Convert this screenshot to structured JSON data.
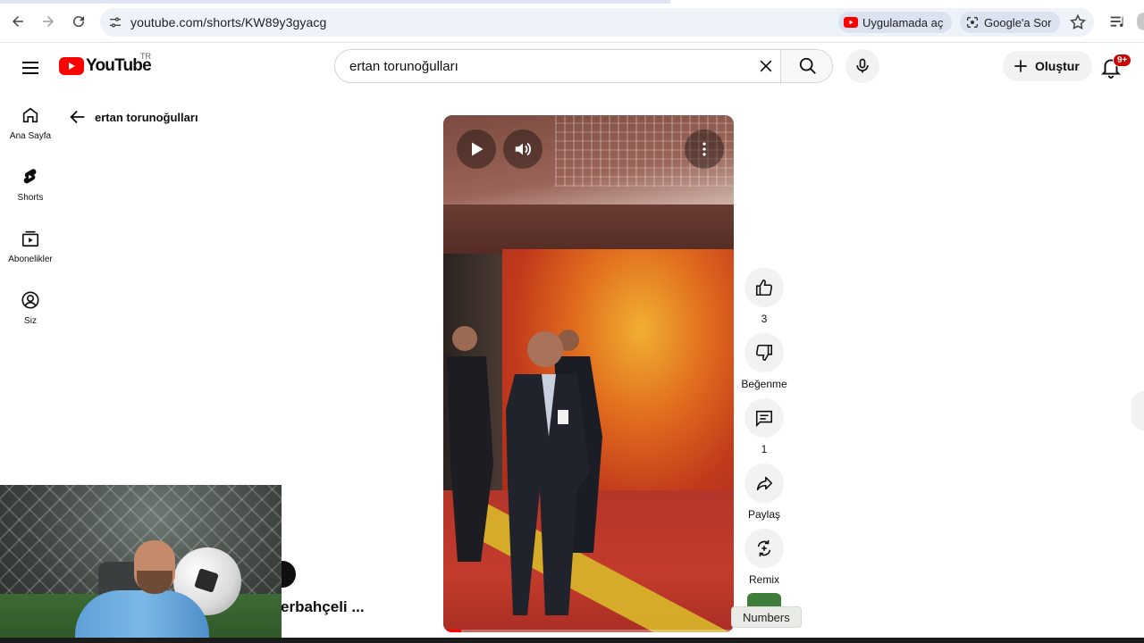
{
  "browser": {
    "url": "youtube.com/shorts/KW89y3gyacg",
    "open_in_app_label": "Uygulamada aç",
    "ask_google_label": "Google'a Sor"
  },
  "masthead": {
    "logo_text": "YouTube",
    "country_code": "TR",
    "search_value": "ertan torunoğulları",
    "create_label": "Oluştur",
    "notification_count": "9+"
  },
  "guide": {
    "items": [
      {
        "label": "Ana Sayfa",
        "icon": "home-icon"
      },
      {
        "label": "Shorts",
        "icon": "shorts-icon"
      },
      {
        "label": "Abonelikler",
        "icon": "subscriptions-icon"
      },
      {
        "label": "Siz",
        "icon": "profile-icon"
      }
    ]
  },
  "back_title": "ertan torunoğulları",
  "actions": {
    "like_count": "3",
    "dislike_label": "Beğenme",
    "comment_count": "1",
    "share_label": "Paylaş",
    "remix_label": "Remix"
  },
  "tooltip": "Numbers",
  "partial_title": "erbahçeli ...",
  "colors": {
    "youtube_red": "#ff0000",
    "badge_red": "#cc0000",
    "chip_bg": "#f2f2f2"
  }
}
